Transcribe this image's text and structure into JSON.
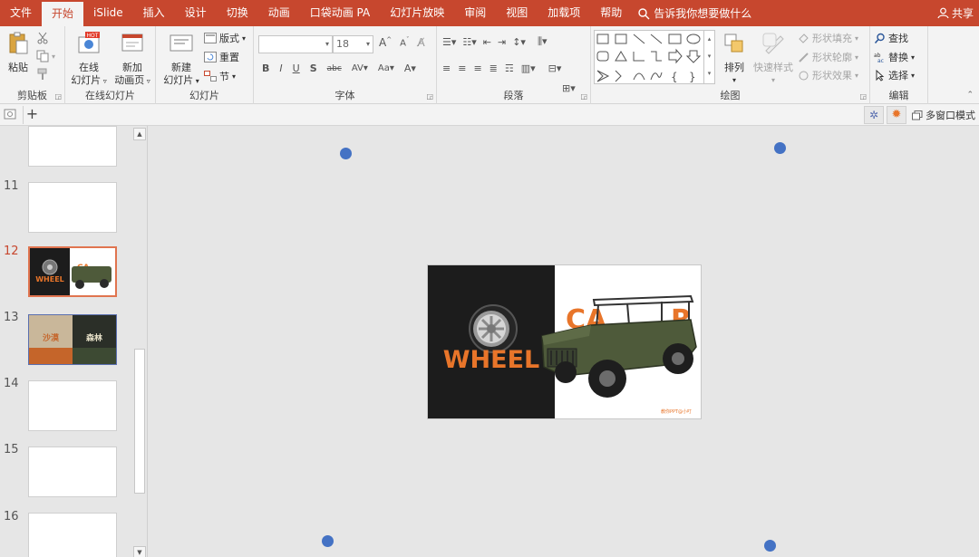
{
  "tabs": [
    "文件",
    "开始",
    "iSlide",
    "插入",
    "设计",
    "切换",
    "动画",
    "口袋动画 PA",
    "幻灯片放映",
    "审阅",
    "视图",
    "加载项",
    "帮助"
  ],
  "active_tab_index": 1,
  "tell_me": "告诉我你想要做什么",
  "share": "共享",
  "ribbon": {
    "clipboard": {
      "paste": "粘贴",
      "label": "剪贴板"
    },
    "online": {
      "btn1_line1": "在线",
      "btn1_line2": "幻灯片",
      "btn2_line1": "新加",
      "btn2_line2": "动画页",
      "hot": "HOT",
      "label": "在线幻灯片"
    },
    "slides": {
      "new_line1": "新建",
      "new_line2": "幻灯片",
      "layout": "版式",
      "reset": "重置",
      "section": "节",
      "label": "幻灯片"
    },
    "font": {
      "font_name": "",
      "font_size": "18",
      "label": "字体"
    },
    "paragraph": {
      "label": "段落"
    },
    "drawing": {
      "arrange": "排列",
      "quick_styles": "快速样式",
      "fill": "形状填充",
      "outline": "形状轮廓",
      "effects": "形状效果",
      "label": "绘图"
    },
    "editing": {
      "find": "查找",
      "replace": "替换",
      "select": "选择",
      "label": "编辑"
    }
  },
  "subbar": {
    "multiwindow": "多窗口模式"
  },
  "thumbnails": {
    "items": [
      {
        "num": "",
        "kind": "blank"
      },
      {
        "num": "11",
        "kind": "blank"
      },
      {
        "num": "12",
        "kind": "wheel-car",
        "selected": true
      },
      {
        "num": "13",
        "kind": "desert-forest"
      },
      {
        "num": "14",
        "kind": "blank"
      },
      {
        "num": "15",
        "kind": "blank"
      },
      {
        "num": "16",
        "kind": "blank"
      }
    ],
    "t13_left": "沙漠",
    "t13_right": "森林"
  },
  "slide": {
    "left_word": "WHEEL",
    "right_word_left": "CA",
    "right_word_right": "R",
    "watermark": "教你PPT@小叮",
    "colors": {
      "dark": "#1c1c1c",
      "accent": "#e8752a"
    }
  }
}
